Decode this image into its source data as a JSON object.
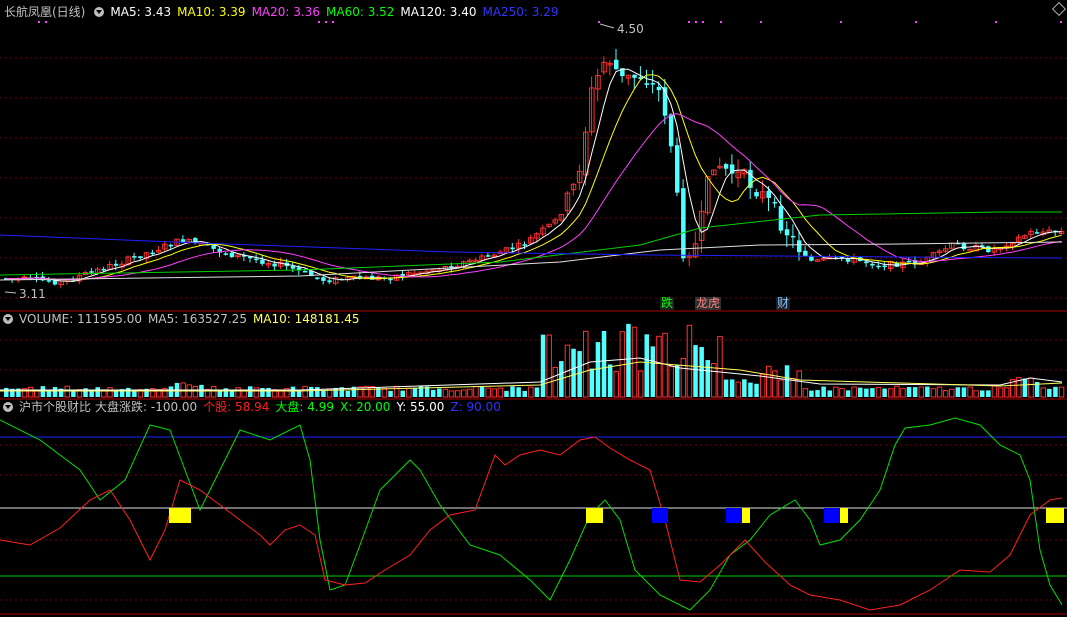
{
  "main_panel": {
    "stock_name": "长航凤凰(日线)",
    "ma": [
      {
        "label": "MA5: 3.43",
        "color": "#ffffff"
      },
      {
        "label": "MA10: 3.39",
        "color": "#ffff00"
      },
      {
        "label": "MA20: 3.36",
        "color": "#ff40ff"
      },
      {
        "label": "MA60: 3.52",
        "color": "#00ff00"
      },
      {
        "label": "MA120: 3.40",
        "color": "#ffffff"
      },
      {
        "label": "MA250: 3.29",
        "color": "#3333ff"
      }
    ],
    "high_label": "4.50",
    "low_label": "3.11",
    "events": [
      {
        "text": "跌",
        "color": "#00ff00",
        "bg": "#202020"
      },
      {
        "text": "龙虎",
        "color": "#ff8080",
        "bg": "#303030"
      },
      {
        "text": "财",
        "color": "#80c0ff",
        "bg": "#202020"
      }
    ]
  },
  "volume_panel": {
    "volume": "VOLUME: 111595.00",
    "ma5": "MA5: 163527.25",
    "ma10": "MA10: 148181.45",
    "colors": {
      "volume": "#c0c0c0",
      "ma5": "#c0c0c0",
      "ma10": "#ffff60"
    }
  },
  "indicator_panel": {
    "name": "沪市个股财比",
    "index_change": "大盘涨跌: -100.00",
    "stock": "个股: 58.94",
    "market": "大盘: 4.99",
    "x": "X: 20.00",
    "y": "Y: 55.00",
    "z": "Z: 90.00",
    "colors": {
      "stock": "#ff2020",
      "market": "#00ff00",
      "x": "#00ff00",
      "y": "#ffffff",
      "z": "#3030ff"
    }
  },
  "colors": {
    "up": "#ff3030",
    "down": "#50ffff",
    "grid": "#800000",
    "frame": "#b00000"
  }
}
